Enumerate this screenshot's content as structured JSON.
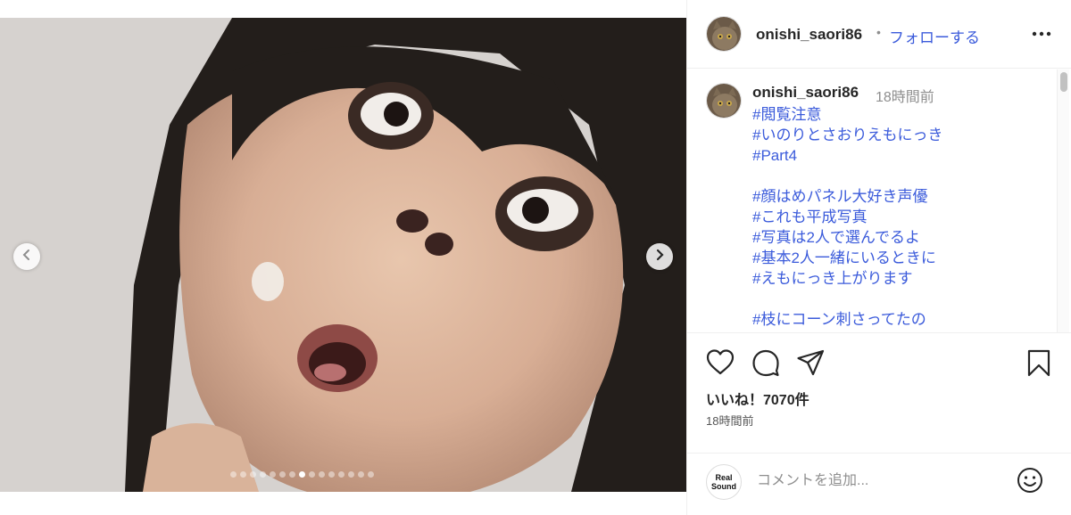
{
  "post": {
    "username": "onishi_saori86",
    "separator": "•",
    "follow_label": "フォローする",
    "more_icon": "more-horizontal-icon"
  },
  "caption": {
    "username": "onishi_saori86",
    "time": "18時間前",
    "tags": [
      "#閲覧注意",
      "#いのりとさおりえもにっき",
      "#Part4",
      "",
      "#顔はめパネル大好き声優",
      "#これも平成写真",
      "#写真は2人で選んでるよ",
      "#基本2人一緒にいるときに",
      "#えもにっき上がります",
      "",
      "#枝にコーン刺さってたの"
    ]
  },
  "carousel": {
    "total_slides": 15,
    "active_index": 7
  },
  "engagement": {
    "likes": "いいね！7070件",
    "time": "18時間前"
  },
  "comment": {
    "placeholder": "コメントを追加...",
    "logo_line1": "Real",
    "logo_line2": "Sound"
  },
  "colors": {
    "link": "#3b5bdb",
    "text": "#262626",
    "muted": "#8e8e8e"
  }
}
